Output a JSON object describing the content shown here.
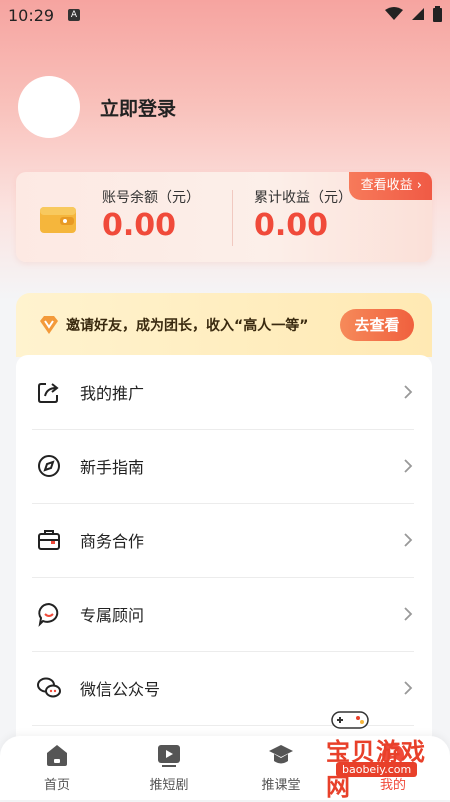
{
  "status": {
    "time": "10:29",
    "a_badge": "A"
  },
  "profile": {
    "login_label": "立即登录"
  },
  "balance": {
    "account_label": "账号余额（元）",
    "account_value": "0.00",
    "earnings_label": "累计收益（元）",
    "earnings_value": "0.00",
    "view_earnings": "查看收益"
  },
  "invite": {
    "text": "邀请好友，成为团长，收入“高人一等”",
    "button": "去查看"
  },
  "menu": {
    "items": [
      {
        "label": "我的推广",
        "icon": "share-icon"
      },
      {
        "label": "新手指南",
        "icon": "compass-icon"
      },
      {
        "label": "商务合作",
        "icon": "briefcase-icon"
      },
      {
        "label": "专属顾问",
        "icon": "chat-bubble-icon"
      },
      {
        "label": "微信公众号",
        "icon": "wechat-icon"
      }
    ]
  },
  "nav": {
    "items": [
      {
        "label": "首页",
        "icon": "home-icon"
      },
      {
        "label": "推短剧",
        "icon": "play-icon"
      },
      {
        "label": "推课堂",
        "icon": "graduation-cap-icon"
      },
      {
        "label": "我的",
        "icon": "profile-icon"
      }
    ]
  },
  "watermark": {
    "title": "宝贝游戏网",
    "url": "baobeiy.com"
  },
  "colors": {
    "accent": "#f04a3a",
    "banner": "#ffe9b3"
  }
}
